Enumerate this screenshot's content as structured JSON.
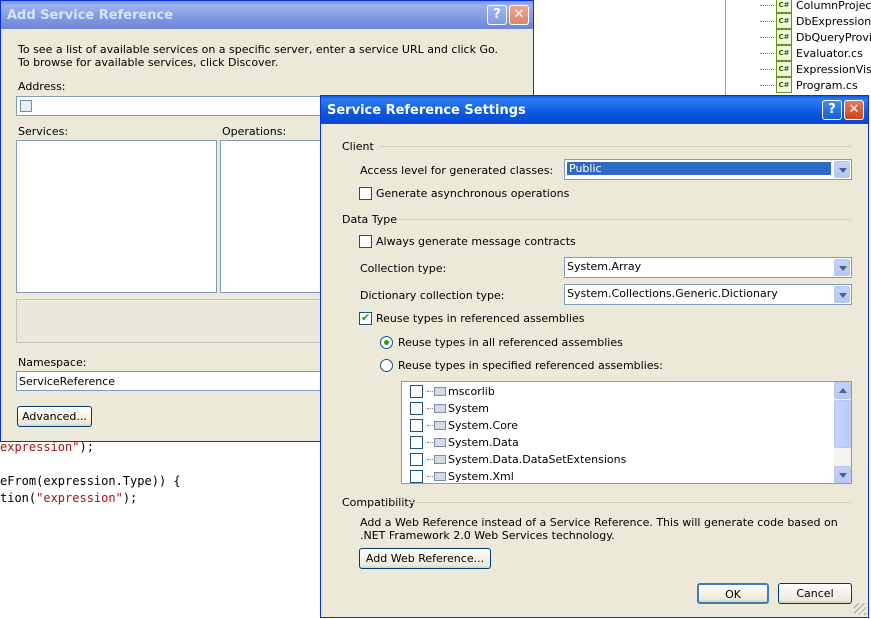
{
  "code_editor": {
    "line1": {
      "str": "expression\"",
      "rest": ");"
    },
    "line2": "eFrom(expression.Type)) {",
    "line3": {
      "pre": "tion(",
      "str": "\"expression\"",
      "rest": ");"
    }
  },
  "solution_explorer": {
    "files": [
      "ColumnProjector.",
      "DbExpressions.",
      "DbQueryProvide",
      "Evaluator.cs",
      "ExpressionVisito",
      "Program.cs"
    ],
    "file_icon_label": "C#"
  },
  "add_service_reference": {
    "title": "Add Service Reference",
    "help_button": "?",
    "close_button": "✕",
    "intro": "To see a list of available services on a specific server, enter a service URL and click Go. To browse for available services, click Discover.",
    "address_label": "Address:",
    "address_value": "",
    "services_label": "Services:",
    "operations_label": "Operations:",
    "namespace_label": "Namespace:",
    "namespace_value": "ServiceReference",
    "advanced_button": "Advanced..."
  },
  "settings_dialog": {
    "title": "Service Reference Settings",
    "help_button": "?",
    "close_button": "✕",
    "client_group": "Client",
    "access_level_label": "Access level for generated classes:",
    "access_level_value": "Public",
    "generate_async_label": "Generate asynchronous operations",
    "generate_async_checked": false,
    "data_type_group": "Data Type",
    "always_generate_label": "Always generate message contracts",
    "always_generate_checked": false,
    "collection_type_label": "Collection type:",
    "collection_type_value": "System.Array",
    "dictionary_type_label": "Dictionary collection type:",
    "dictionary_type_value": "System.Collections.Generic.Dictionary",
    "reuse_types_label": "Reuse types in referenced assemblies",
    "reuse_types_checked": true,
    "reuse_all_label": "Reuse types in all referenced assemblies",
    "reuse_all_selected": true,
    "reuse_specified_label": "Reuse types in specified referenced assemblies:",
    "reuse_specified_selected": false,
    "assemblies": [
      {
        "name": "mscorlib",
        "checked": false
      },
      {
        "name": "System",
        "checked": false
      },
      {
        "name": "System.Core",
        "checked": false
      },
      {
        "name": "System.Data",
        "checked": false
      },
      {
        "name": "System.Data.DataSetExtensions",
        "checked": false
      },
      {
        "name": "System.Xml",
        "checked": false
      }
    ],
    "compatibility_group": "Compatibility",
    "compatibility_text": "Add a Web Reference instead of a Service Reference. This will generate code based on .NET Framework 2.0 Web Services technology.",
    "add_web_reference_button": "Add Web Reference...",
    "ok_button": "OK",
    "cancel_button": "Cancel"
  }
}
